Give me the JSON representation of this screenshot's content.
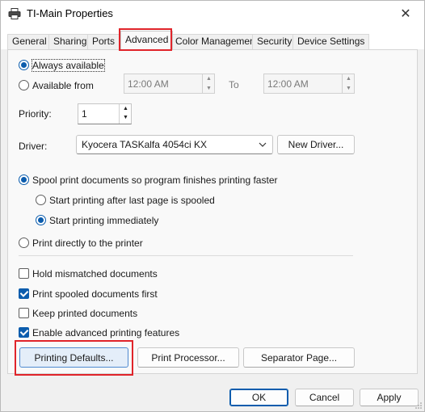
{
  "window": {
    "title": "TI-Main Properties",
    "close": "✕"
  },
  "tabs": [
    "General",
    "Sharing",
    "Ports",
    "Advanced",
    "Color Management",
    "Security",
    "Device Settings"
  ],
  "availability": {
    "always_label": "Always available",
    "from_label": "Available from",
    "from_time": "12:00 AM",
    "to_label": "To",
    "to_time": "12:00 AM",
    "selected": "always"
  },
  "priority": {
    "label": "Priority:",
    "value": "1"
  },
  "driver": {
    "label": "Driver:",
    "value": "Kyocera TASKalfa 4054ci KX",
    "new_button": "New Driver..."
  },
  "spool": {
    "spool_label": "Spool print documents so program finishes printing faster",
    "after_last_label": "Start printing after last page is spooled",
    "immediately_label": "Start printing immediately",
    "direct_label": "Print directly to the printer",
    "selected": "spool",
    "start_selected": "immediately"
  },
  "options": {
    "hold_mismatched": {
      "label": "Hold mismatched documents",
      "checked": false
    },
    "spooled_first": {
      "label": "Print spooled documents first",
      "checked": true
    },
    "keep_printed": {
      "label": "Keep printed documents",
      "checked": false
    },
    "advanced_features": {
      "label": "Enable advanced printing features",
      "checked": true
    }
  },
  "action_buttons": {
    "printing_defaults": "Printing Defaults...",
    "print_processor": "Print Processor...",
    "separator_page": "Separator Page..."
  },
  "footer": {
    "ok": "OK",
    "cancel": "Cancel",
    "apply": "Apply"
  },
  "icons": {
    "title_icon": "printer-icon",
    "dropdown": "chevron-down-icon",
    "spin_up": "spin-up-icon",
    "spin_down": "spin-down-icon"
  },
  "colors": {
    "accent": "#0b5cad",
    "highlight_box": "#e0242a",
    "accent_button_bg": "#e4eef9"
  }
}
